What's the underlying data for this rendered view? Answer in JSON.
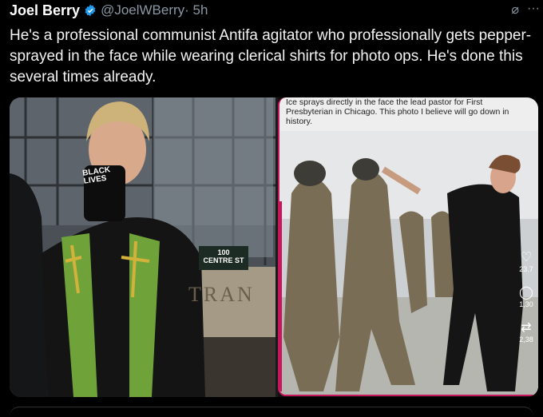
{
  "author": {
    "name": "Joel Berry",
    "handle": "@JoelWBerry",
    "time": "· 5h"
  },
  "tweet_text": "He's a professional communist Antifa agitator who professionally gets pepper-sprayed in the face while wearing clerical shirts for photo ops. He's done this several times already.",
  "left_photo": {
    "mask_text": "BLACK LIVES",
    "sign_line1": "100",
    "sign_line2": "CENTRE ST",
    "building_text": "TRAN"
  },
  "right_photo": {
    "caption": "Ice sprays directly in the face the lead pastor for First Presbyterian in Chicago. This photo I believe will go down in history.",
    "counts": {
      "likes": "23.7",
      "replies": "1,30",
      "reposts": "2,38"
    }
  },
  "colors": {
    "verified": "#1d9bf0",
    "accent_pink": "#c7165b"
  }
}
